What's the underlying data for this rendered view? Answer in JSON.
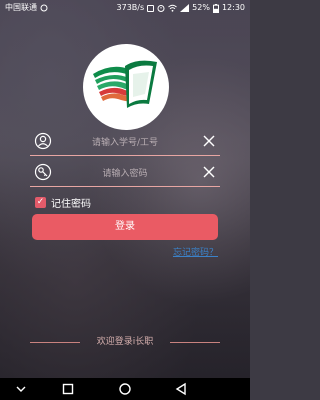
{
  "status_bar": {
    "carrier": "中国联通",
    "speed": "373B/s",
    "battery": "52%",
    "time": "12:30"
  },
  "login": {
    "username_placeholder": "请输入学号/工号",
    "password_placeholder": "请输入密码",
    "remember_label": "记住密码",
    "remember_checked": true,
    "login_button": "登录",
    "forgot_link": "忘记密码？"
  },
  "footer": {
    "welcome_text": "欢迎登录i长职"
  },
  "colors": {
    "accent": "#ea5b64",
    "link": "#3b82c9",
    "underline": "#e8a6a3"
  },
  "icons": {
    "logo": "school-logo",
    "user": "user-icon",
    "password": "key-icon",
    "clear": "close-icon",
    "back": "back-icon",
    "home": "home-icon",
    "recents": "recents-icon",
    "dropdown": "chevron-down-icon"
  }
}
